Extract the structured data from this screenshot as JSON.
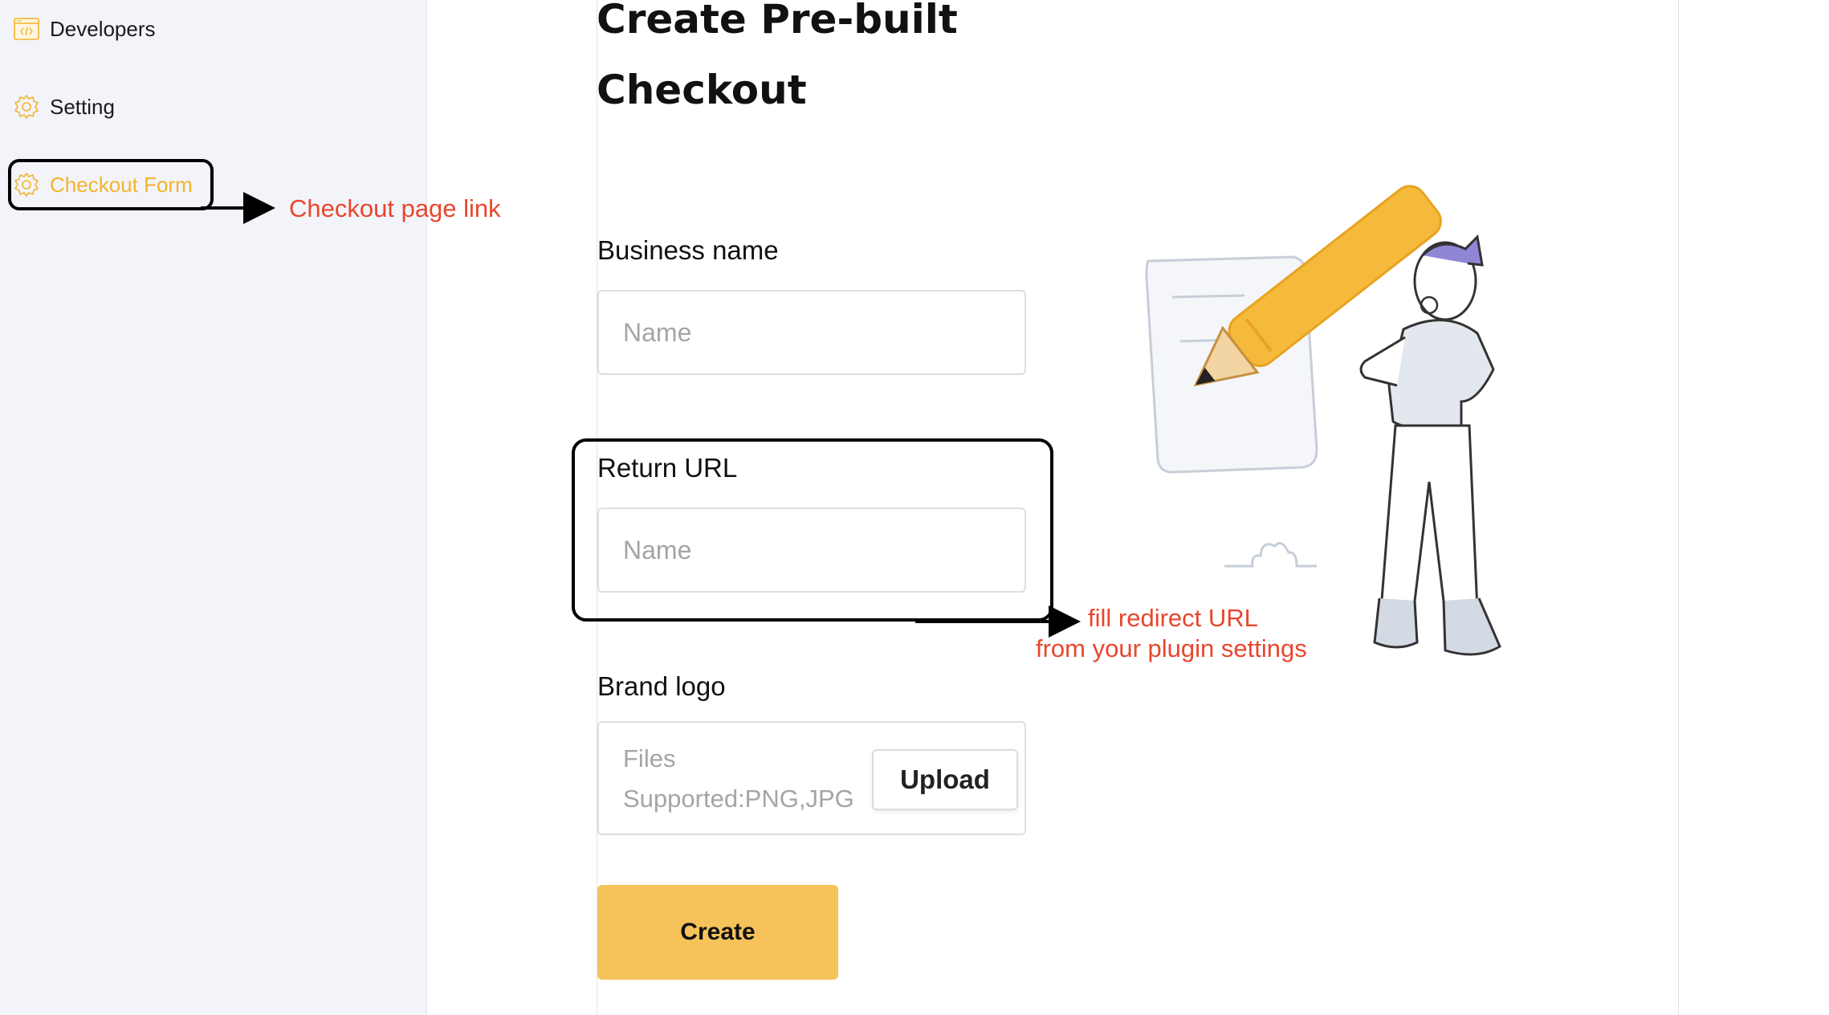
{
  "sidebar": {
    "items": [
      {
        "label": "Developers",
        "icon": "code-window-icon"
      },
      {
        "label": "Setting",
        "icon": "gear-icon"
      },
      {
        "label": "Checkout Form",
        "icon": "gear-icon",
        "active": true
      }
    ]
  },
  "main": {
    "title_line1": "Create Pre-built",
    "title_line2": "Checkout",
    "fields": {
      "business_name": {
        "label": "Business name",
        "placeholder": "Name",
        "value": ""
      },
      "return_url": {
        "label": "Return URL",
        "placeholder": "Name",
        "value": ""
      },
      "brand_logo": {
        "label": "Brand logo",
        "hint_line1": "Files",
        "hint_line2": "Supported:PNG,JPG",
        "upload_label": "Upload"
      }
    },
    "create_label": "Create"
  },
  "annotations": {
    "checkout_link": "Checkout page link",
    "redirect_line1": "fill redirect URL",
    "redirect_line2": "from your plugin settings"
  },
  "colors": {
    "accent": "#f2b42a",
    "button": "#f6c25a",
    "annotation": "#e8462e",
    "sidebar_bg": "#f3f4f9"
  }
}
